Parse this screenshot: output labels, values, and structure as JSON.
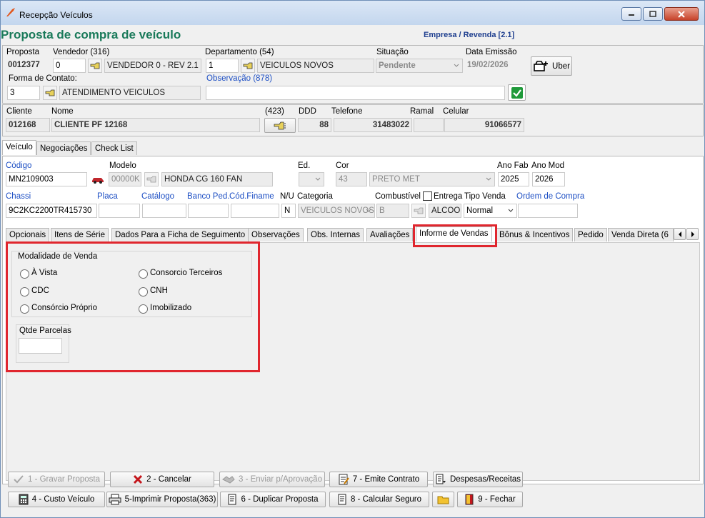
{
  "window": {
    "title": "Recepção Veículos"
  },
  "header": {
    "page_title": "Proposta de compra de veículo",
    "empresa": "Empresa / Revenda [2.1]"
  },
  "proposal": {
    "proposta_label": "Proposta",
    "proposta_value": "0012377",
    "vendedor_label": "Vendedor (316)",
    "vendedor_code": "0",
    "vendedor_name": "VENDEDOR 0 - REV 2.1",
    "departamento_label": "Departamento (54)",
    "departamento_code": "1",
    "departamento_name": "VEICULOS NOVOS",
    "situacao_label": "Situação",
    "situacao_value": "Pendente",
    "data_emissao_label": "Data Emissão",
    "data_emissao_value": "19/02/2026",
    "uber_label": "Uber",
    "forma_contato_label": "Forma de Contato:",
    "forma_contato_code": "3",
    "forma_contato_name": "ATENDIMENTO VEICULOS",
    "observacao_label": "Observação (878)",
    "observacao_value": ""
  },
  "client": {
    "cliente_label": "Cliente",
    "cliente_value": "012168",
    "nome_label": "Nome",
    "nome_value": "CLIENTE PF 12168",
    "code_label": "(423)",
    "ddd_label": "DDD",
    "ddd_value": "88",
    "telefone_label": "Telefone",
    "telefone_value": "31483022",
    "ramal_label": "Ramal",
    "ramal_value": "",
    "celular_label": "Celular",
    "celular_value": "91066577"
  },
  "main_tabs": [
    {
      "label": "Veículo"
    },
    {
      "label": "Negociações"
    },
    {
      "label": "Check List"
    }
  ],
  "vehicle": {
    "codigo_label": "Código",
    "codigo_value": "MN2109003",
    "modelo_label": "Modelo",
    "modelo_code": "00000K",
    "modelo_name": "HONDA CG 160 FAN",
    "ed_label": "Ed.",
    "ed_value": "",
    "cor_label": "Cor",
    "cor_code": "43",
    "cor_name": "PRETO MET",
    "ano_fab_label": "Ano Fab",
    "ano_fab_value": "2025",
    "ano_mod_label": "Ano Mod",
    "ano_mod_value": "2026",
    "chassi_label": "Chassi",
    "chassi_value": "9C2KC2200TR415730",
    "placa_label": "Placa",
    "placa_value": "",
    "catalogo_label": "Catálogo",
    "catalogo_value": "",
    "banco_label": "Banco Ped.",
    "banco_value": "",
    "finame_label": "Cód.Finame",
    "finame_value": "",
    "nu_label": "N/U",
    "nu_value": "N",
    "categoria_label": "Categoria",
    "categoria_value": "VEICULOS NOVOS",
    "combustivel_label": "Combustível",
    "combustivel_code": "B",
    "combustivel_name": "ALCOOL",
    "entrega_label": "Entrega",
    "tipo_venda_label": "Tipo Venda",
    "tipo_venda_value": "Normal",
    "ordem_compra_label": "Ordem de Compra",
    "ordem_compra_value": ""
  },
  "sub_tabs": [
    {
      "label": "Opcionais"
    },
    {
      "label": "Itens de Série"
    },
    {
      "label": "Dados Para a Ficha de Seguimento"
    },
    {
      "label": "Observações"
    },
    {
      "label": "Obs. Internas"
    },
    {
      "label": "Avaliações"
    },
    {
      "label": "Informe de Vendas"
    },
    {
      "label": "Bônus & Incentivos"
    },
    {
      "label": "Pedido"
    },
    {
      "label": "Venda Direta (6"
    }
  ],
  "informe": {
    "modalidade_label": "Modalidade de Venda",
    "options": [
      {
        "label": "À Vista"
      },
      {
        "label": "Consorcio Terceiros"
      },
      {
        "label": "CDC"
      },
      {
        "label": "CNH"
      },
      {
        "label": "Consórcio Próprio"
      },
      {
        "label": "Imobilizado"
      }
    ],
    "qtde_parcelas_label": "Qtde Parcelas",
    "qtde_parcelas_value": ""
  },
  "buttons": {
    "gravar": "1 - Gravar Proposta",
    "cancelar": "2 - Cancelar",
    "enviar": "3 - Enviar p/Aprovação",
    "emite_contrato": "7 - Emite Contrato",
    "despesas": "Despesas/Receitas",
    "custo": "4 - Custo Veículo",
    "imprimir": "5-Imprimir Proposta(363)",
    "duplicar": "6 - Duplicar Proposta",
    "seguro": "8 - Calcular Seguro",
    "fechar": "9 - Fechar"
  },
  "colors": {
    "title_green": "#1a7a5a",
    "label_blue": "#1d4fc4",
    "highlight_red": "#e0262e"
  }
}
